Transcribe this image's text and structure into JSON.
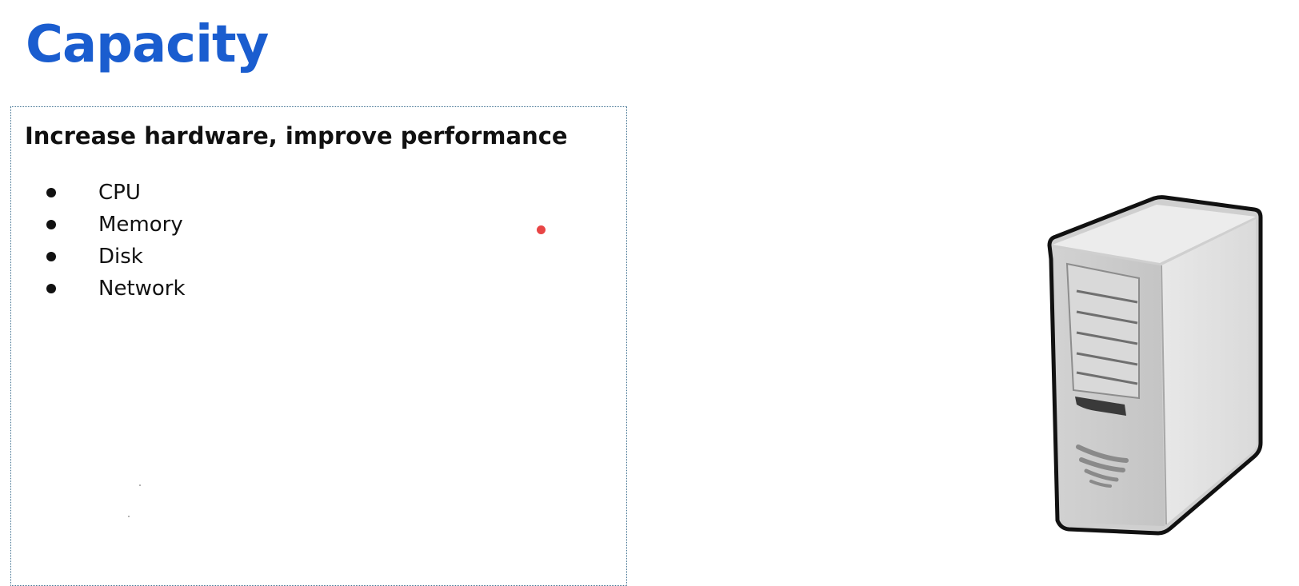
{
  "slide": {
    "title": "Capacity",
    "title_color": "#1a5dcf"
  },
  "content_box": {
    "heading": "Increase hardware, improve performance",
    "bullets": [
      {
        "label": "CPU"
      },
      {
        "label": "Memory"
      },
      {
        "label": "Disk"
      },
      {
        "label": "Network"
      }
    ]
  },
  "illustration": {
    "icon": "server-tower-icon"
  },
  "colors": {
    "pointer": "#e84545",
    "box_border": "#3d6f8f",
    "text": "#111111"
  }
}
